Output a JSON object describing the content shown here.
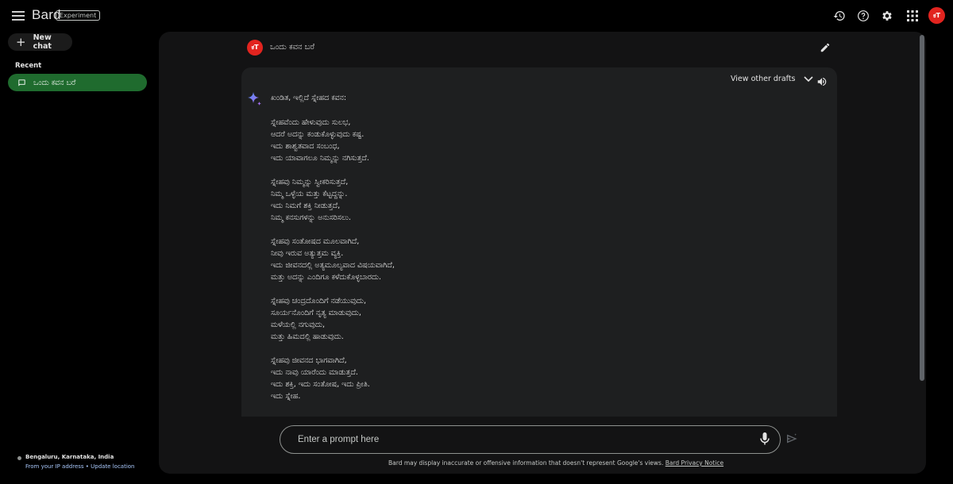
{
  "header": {
    "logo": "Bard",
    "badge": "Experiment",
    "avatar_initials": "ಕT"
  },
  "sidebar": {
    "new_chat_label": "New chat",
    "recent_label": "Recent",
    "recent_items": [
      {
        "label": "ಒಂದು ಕವನ ಬರೆ"
      }
    ],
    "location": {
      "place": "Bengaluru, Karnataka, India",
      "source_prefix": "From your IP address",
      "separator": " • ",
      "update_link": "Update location"
    }
  },
  "conversation": {
    "user_initials": "ಕT",
    "user_prompt": "ಒಂದು ಕವನ ಬರೆ",
    "view_drafts_label": "View other drafts",
    "response_intro": "ಖಂಡಿತ, ಇಲ್ಲಿದೆ ಸ್ನೇಹದ ಕವನ:",
    "poem": [
      [
        "ಸ್ನೇಹವೆಂದು ಹೇಳುವುದು ಸುಲಭ,",
        "ಆದರೆ ಅದನ್ನು ಕಂಡುಕೊಳ್ಳುವುದು ಕಷ್ಟ.",
        "ಇದು ಶಾಶ್ವತವಾದ ಸಂಬಂಧ,",
        "ಇದು ಯಾವಾಗಲೂ ನಿಮ್ಮನ್ನು ನಗಿಸುತ್ತದೆ."
      ],
      [
        "ಸ್ನೇಹವು ನಿಮ್ಮನ್ನು ಸ್ವೀಕರಿಸುತ್ತದೆ,",
        "ನಿಮ್ಮ ಒಳ್ಳೆಯ ಮತ್ತು ಕೆಟ್ಟದ್ದನ್ನು.",
        "ಇದು ನಿಮಗೆ ಶಕ್ತಿ ನೀಡುತ್ತದೆ,",
        "ನಿಮ್ಮ ಕನಸುಗಳನ್ನು ಅನುಸರಿಸಲು."
      ],
      [
        "ಸ್ನೇಹವು ಸಂತೋಷದ ಮೂಲವಾಗಿದೆ,",
        "ನೀವು ಇರುವ ಅತ್ಯುತ್ತಮ ವ್ಯಕ್ತಿ.",
        "ಇದು ಜೀವನದಲ್ಲಿ ಅತ್ಯಮೂಲ್ಯವಾದ ವಿಷಯವಾಗಿದೆ,",
        "ಮತ್ತು ಅದನ್ನು ಎಂದಿಗೂ ಕಳೆದುಕೊಳ್ಳಬಾರದು."
      ],
      [
        "ಸ್ನೇಹವು ಚಂದ್ರದೊಂದಿಗೆ ನಡೆಯುವುದು,",
        "ಸೂರ್ಯನೊಂದಿಗೆ ನೃತ್ಯ ಮಾಡುವುದು,",
        "ಮಳೆಯಲ್ಲಿ ನಗುವುದು,",
        "ಮತ್ತು ಹಿಮದಲ್ಲಿ ಹಾಡುವುದು."
      ],
      [
        "ಸ್ನೇಹವು ಜೀವನದ ಭಾಗವಾಗಿದೆ,",
        "ಇದು ನಾವು ಯಾರೆಂದು ಮಾಡುತ್ತದೆ.",
        "ಇದು ಶಕ್ತಿ, ಇದು ಸಂತೋಷ, ಇದು ಪ್ರೀತಿ.",
        "ಇದು ಸ್ನೇಹ."
      ]
    ]
  },
  "input": {
    "placeholder": "Enter a prompt here"
  },
  "footer": {
    "disclaimer": "Bard may display inaccurate or offensive information that doesn't represent Google's views. ",
    "privacy_link": "Bard Privacy Notice"
  },
  "colors": {
    "accent_green": "#1f6b2e",
    "avatar_red": "#e2241f",
    "link_blue": "#a8c7fa"
  }
}
